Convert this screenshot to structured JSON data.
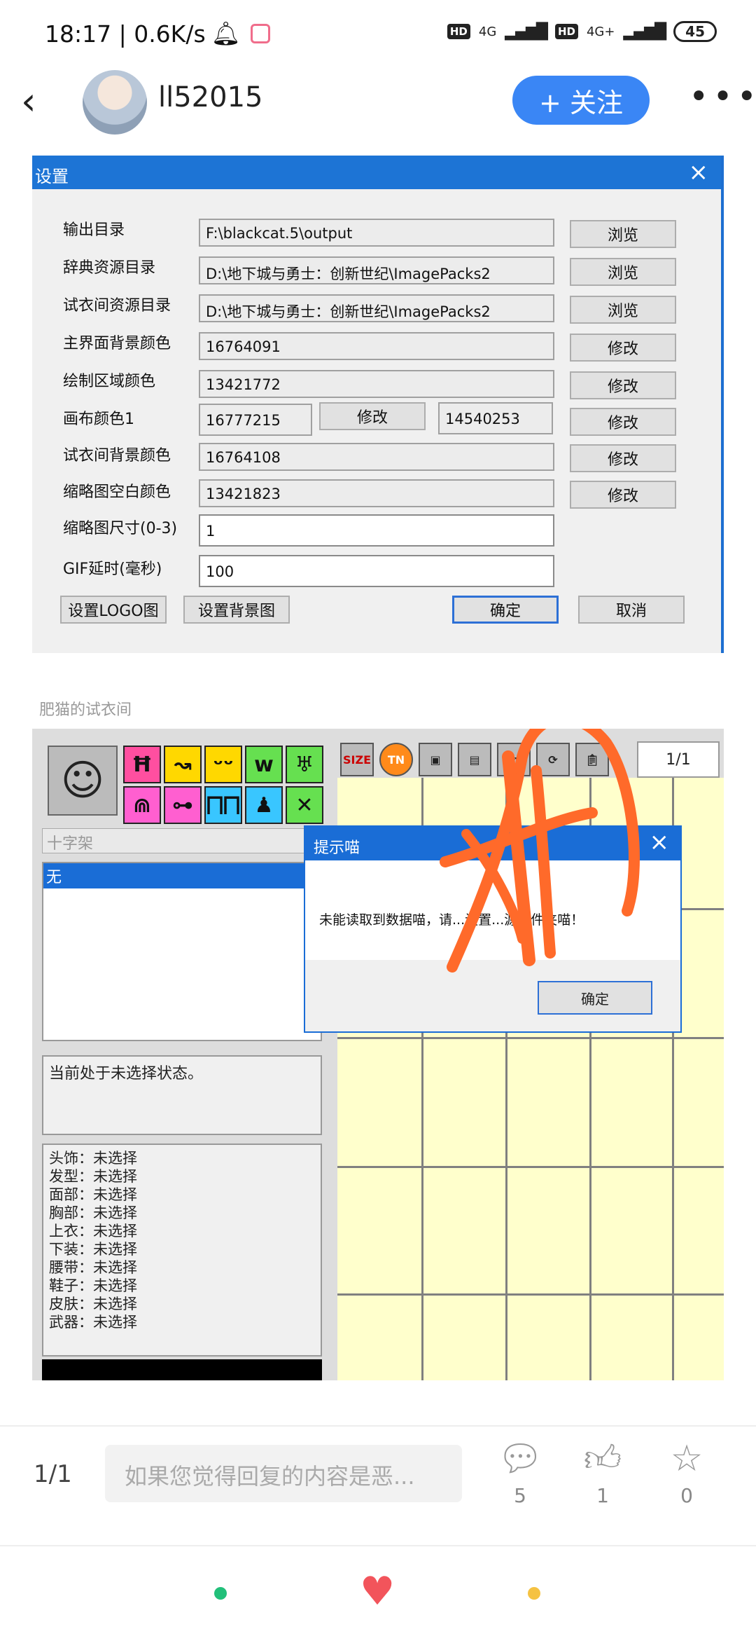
{
  "status_bar": {
    "time_speed": "18:17 | 0.6K/s",
    "hd1": "HD",
    "net1": "4G",
    "hd2": "HD",
    "net2": "4G+",
    "battery": "45"
  },
  "header": {
    "back_icon": "‹",
    "username": "ll52015",
    "follow_label": "+ 关注",
    "more_icon": "•••"
  },
  "settings": {
    "title": "设置",
    "close": "×",
    "rows": [
      {
        "label": "输出目录",
        "value": "F:\\blackcat.5\\output",
        "button": "浏览"
      },
      {
        "label": "辞典资源目录",
        "value": "D:\\地下城与勇士：创新世纪\\ImagePacks2",
        "button": "浏览"
      },
      {
        "label": "试衣间资源目录",
        "value": "D:\\地下城与勇士：创新世纪\\ImagePacks2",
        "button": "浏览"
      },
      {
        "label": "主界面背景颜色",
        "value": "16764091",
        "button": "修改"
      },
      {
        "label": "绘制区域颜色",
        "value": "13421772",
        "button": "修改"
      }
    ],
    "canvas_row": {
      "label": "画布颜色1",
      "value1": "16777215",
      "mid_button": "修改",
      "value2": "14540253",
      "button": "修改"
    },
    "rows2": [
      {
        "label": "试衣间背景颜色",
        "value": "16764108",
        "button": "修改"
      },
      {
        "label": "缩略图空白颜色",
        "value": "13421823",
        "button": "修改"
      }
    ],
    "thumb_label": "缩略图尺寸(0-3)",
    "thumb_value": "1",
    "gif_label": "GIF延时(毫秒)",
    "gif_value": "100",
    "btn_logo": "设置LOGO图",
    "btn_bg": "设置背景图",
    "btn_ok": "确定",
    "btn_cancel": "取消"
  },
  "dressing": {
    "title": "肥猫的试衣间",
    "pager": "1/1",
    "combo": "十字架",
    "list_selected": "无",
    "state_text": "当前处于未选择状态。",
    "slots": [
      {
        "name": "头饰",
        "value": "未选择"
      },
      {
        "name": "发型",
        "value": "未选择"
      },
      {
        "name": "面部",
        "value": "未选择"
      },
      {
        "name": "胸部",
        "value": "未选择"
      },
      {
        "name": "上衣",
        "value": "未选择"
      },
      {
        "name": "下装",
        "value": "未选择"
      },
      {
        "name": "腰带",
        "value": "未选择"
      },
      {
        "name": "鞋子",
        "value": "未选择"
      },
      {
        "name": "皮肤",
        "value": "未选择"
      },
      {
        "name": "武器",
        "value": "未选择"
      }
    ],
    "dialog": {
      "title": "提示喵",
      "close": "×",
      "message": "未能读取到数据喵，请...设置...源文件夹喵！",
      "ok": "确定"
    },
    "tool_labels": [
      "SIZE",
      "TN"
    ],
    "colors": {
      "yellow_canvas": "#ffffcc",
      "selection": "#1a6dd6",
      "annotation": "#ff6a2a"
    }
  },
  "bottom": {
    "page": "1/1",
    "reply_placeholder": "如果您觉得回复的内容是恶...",
    "comment_count": "5",
    "like_count": "1",
    "fav_count": "0"
  }
}
